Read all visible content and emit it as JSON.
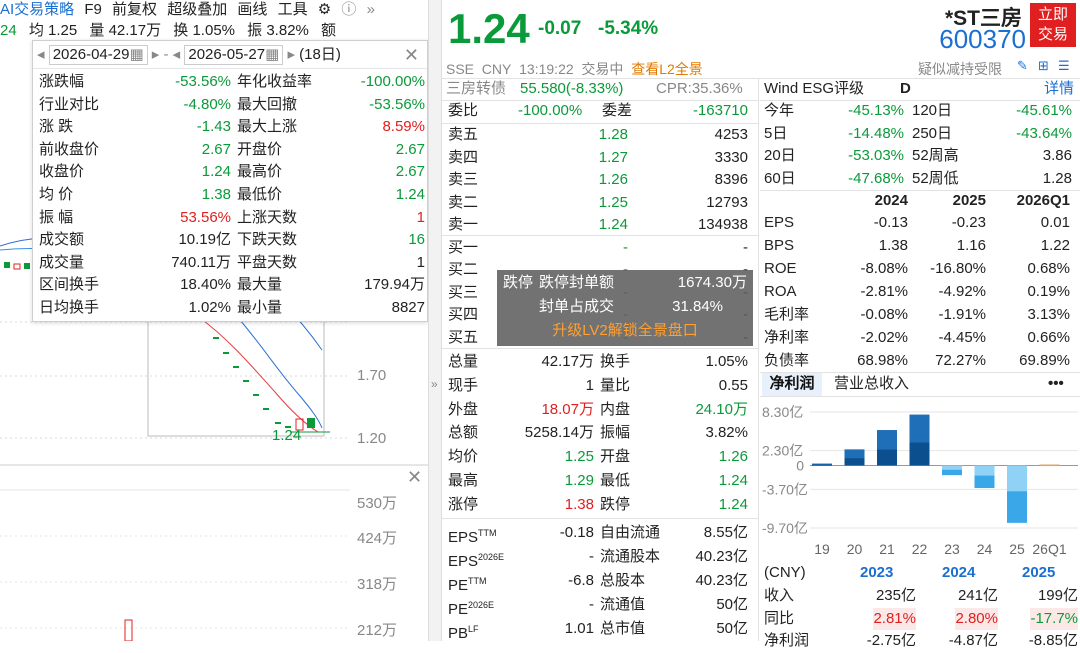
{
  "top": {
    "tools": [
      "AI交易策略",
      "F9",
      "前复权",
      "超级叠加",
      "画线",
      "工具"
    ],
    "stats": [
      "24",
      "均 1.25",
      "量 42.17万",
      "换 1.05%",
      "振 3.82%",
      "额"
    ]
  },
  "popup": {
    "date_from": "2026-04-29",
    "date_to": "2026-05-27",
    "days": "(18日)",
    "rows": [
      {
        "l1": "涨跌幅",
        "v1": "-53.56%",
        "c1": "green",
        "l2": "年化收益率",
        "v2": "-100.00%",
        "c2": "green"
      },
      {
        "l1": "行业对比",
        "v1": "-4.80%",
        "c1": "green",
        "l2": "最大回撤",
        "v2": "-53.56%",
        "c2": "green"
      },
      {
        "l1": "涨  跌",
        "v1": "-1.43",
        "c1": "green",
        "l2": "最大上涨",
        "v2": "8.59%",
        "c2": "red"
      },
      {
        "l1": "前收盘价",
        "v1": "2.67",
        "c1": "green",
        "l2": "开盘价",
        "v2": "2.67",
        "c2": "green"
      },
      {
        "l1": "收盘价",
        "v1": "1.24",
        "c1": "green",
        "l2": "最高价",
        "v2": "2.67",
        "c2": "green"
      },
      {
        "l1": "均  价",
        "v1": "1.38",
        "c1": "green",
        "l2": "最低价",
        "v2": "1.24",
        "c2": "green"
      },
      {
        "l1": "振  幅",
        "v1": "53.56%",
        "c1": "red",
        "l2": "上涨天数",
        "v2": "1",
        "c2": "red"
      },
      {
        "l1": "成交额",
        "v1": "10.19亿",
        "c1": "",
        "l2": "下跌天数",
        "v2": "16",
        "c2": "green"
      },
      {
        "l1": "成交量",
        "v1": "740.11万",
        "c1": "",
        "l2": "平盘天数",
        "v2": "1",
        "c2": ""
      },
      {
        "l1": "区间换手",
        "v1": "18.40%",
        "c1": "",
        "l2": "最大量",
        "v2": "179.94万",
        "c2": ""
      },
      {
        "l1": "日均换手",
        "v1": "1.02%",
        "c1": "",
        "l2": "最小量",
        "v2": "8827",
        "c2": ""
      }
    ]
  },
  "chart_axis": {
    "price_ticks": [
      "1.70",
      "1.20"
    ],
    "last_price": "1.24",
    "vol_ticks": [
      "530万",
      "424万",
      "318万",
      "212万"
    ]
  },
  "quote": {
    "price": "1.24",
    "change": "-0.07",
    "change_pct": "-5.34%",
    "name": "*ST三房",
    "code": "600370",
    "trade_btn": [
      "立即",
      "交易"
    ],
    "exchange": "SSE",
    "currency": "CNY",
    "time": "13:19:22",
    "status": "交易中",
    "l2_link": "查看L2全景",
    "risk": "疑似减持受限"
  },
  "bond": {
    "name": "三房转债",
    "price": "55.580(-8.33%)",
    "cpr": "CPR:35.36%"
  },
  "orderbook": {
    "weibi_label": "委比",
    "weibi": "-100.00%",
    "weicha_label": "委差",
    "weicha": "-163710",
    "asks": [
      {
        "label": "卖五",
        "price": "1.28",
        "vol": "4253"
      },
      {
        "label": "卖四",
        "price": "1.27",
        "vol": "3330"
      },
      {
        "label": "卖三",
        "price": "1.26",
        "vol": "8396"
      },
      {
        "label": "卖二",
        "price": "1.25",
        "vol": "12793"
      },
      {
        "label": "卖一",
        "price": "1.24",
        "vol": "134938"
      }
    ],
    "bids": [
      {
        "label": "买一",
        "price": "-",
        "vol": "-"
      },
      {
        "label": "买二",
        "price": "-",
        "vol": "-"
      },
      {
        "label": "买三",
        "price": "-",
        "vol": "-"
      },
      {
        "label": "买四",
        "price": "-",
        "vol": "-"
      },
      {
        "label": "买五",
        "price": "-",
        "vol": "-"
      }
    ]
  },
  "overlay": {
    "r1a": "跌停",
    "r1b": "跌停封单额",
    "r1c": "1674.30万",
    "r2a": "封单占成交",
    "r2b": "31.84%",
    "r3": "升级LV2解锁全景盘口"
  },
  "summary": [
    {
      "l1": "总量",
      "v1": "42.17万",
      "c1": "",
      "l2": "换手",
      "v2": "1.05%",
      "c2": ""
    },
    {
      "l1": "现手",
      "v1": "1",
      "c1": "",
      "l2": "量比",
      "v2": "0.55",
      "c2": ""
    },
    {
      "l1": "外盘",
      "v1": "18.07万",
      "c1": "red",
      "l2": "内盘",
      "v2": "24.10万",
      "c2": "green"
    },
    {
      "l1": "总额",
      "v1": "5258.14万",
      "c1": "",
      "l2": "振幅",
      "v2": "3.82%",
      "c2": ""
    },
    {
      "l1": "均价",
      "v1": "1.25",
      "c1": "green",
      "l2": "开盘",
      "v2": "1.26",
      "c2": "green"
    },
    {
      "l1": "最高",
      "v1": "1.29",
      "c1": "green",
      "l2": "最低",
      "v2": "1.24",
      "c2": "green"
    },
    {
      "l1": "涨停",
      "v1": "1.38",
      "c1": "red",
      "l2": "跌停",
      "v2": "1.24",
      "c2": "green"
    }
  ],
  "valuation": [
    {
      "l1": "EPS",
      "s1": "TTM",
      "v1": "-0.18",
      "l2": "自由流通",
      "v2": "8.55亿"
    },
    {
      "l1": "EPS",
      "s1": "2026E",
      "v1": "-",
      "l2": "流通股本",
      "v2": "40.23亿"
    },
    {
      "l1": "PE",
      "s1": "TTM",
      "v1": "-6.8",
      "l2": "总股本",
      "v2": "40.23亿"
    },
    {
      "l1": "PE",
      "s1": "2026E",
      "v1": "-",
      "l2": "流通值",
      "v2": "50亿"
    },
    {
      "l1": "PB",
      "s1": "LF",
      "v1": "1.01",
      "l2": "总市值",
      "v2": "50亿"
    }
  ],
  "esg": {
    "label": "Wind ESG评级",
    "grade": "D",
    "detail": "详情"
  },
  "returns": [
    {
      "l1": "今年",
      "v1": "-45.13%",
      "l2": "120日",
      "v2": "-45.61%"
    },
    {
      "l1": "5日",
      "v1": "-14.48%",
      "l2": "250日",
      "v2": "-43.64%"
    },
    {
      "l1": "20日",
      "v1": "-53.03%",
      "l2": "52周高",
      "v2": "3.86"
    },
    {
      "l1": "60日",
      "v1": "-47.68%",
      "l2": "52周低",
      "v2": "1.28"
    }
  ],
  "fin": {
    "headers": [
      "2024",
      "2025",
      "2026Q1"
    ],
    "rows": [
      {
        "label": "EPS",
        "vals": [
          "-0.13",
          "-0.23",
          "0.01"
        ]
      },
      {
        "label": "BPS",
        "vals": [
          "1.38",
          "1.16",
          "1.22"
        ]
      },
      {
        "label": "ROE",
        "vals": [
          "-8.08%",
          "-16.80%",
          "0.68%"
        ]
      },
      {
        "label": "ROA",
        "vals": [
          "-2.81%",
          "-4.92%",
          "0.19%"
        ]
      },
      {
        "label": "毛利率",
        "vals": [
          "-0.08%",
          "-1.91%",
          "3.13%"
        ]
      },
      {
        "label": "净利率",
        "vals": [
          "-2.02%",
          "-4.45%",
          "0.66%"
        ]
      },
      {
        "label": "负债率",
        "vals": [
          "68.98%",
          "72.27%",
          "69.89%"
        ]
      }
    ]
  },
  "bartabs": {
    "tab1": "净利润",
    "tab2": "营业总收入",
    "more": "•••"
  },
  "chart_data": {
    "type": "bar",
    "categories": [
      "19",
      "20",
      "21",
      "22",
      "23",
      "24",
      "25",
      "26Q1"
    ],
    "y_ticks": [
      "8.30亿",
      "2.30亿",
      "0",
      "-3.70亿",
      "-9.70亿"
    ],
    "ylim": [
      -9.7,
      8.3
    ],
    "values": [
      0.3,
      2.5,
      5.5,
      7.9,
      -1.5,
      -3.5,
      -8.9,
      0.15
    ]
  },
  "annual": {
    "unit": "(CNY)",
    "years": [
      "2023",
      "2024",
      "2025"
    ],
    "rows": [
      {
        "label": "收入",
        "vals": [
          "235亿",
          "241亿",
          "199亿"
        ],
        "color": ""
      },
      {
        "label": "同比",
        "vals": [
          "2.81%",
          "2.80%",
          "-17.7%"
        ],
        "color": "mixed"
      },
      {
        "label": "净利润",
        "vals": [
          "-2.75亿",
          "-4.87亿",
          "-8.85亿"
        ],
        "color": ""
      }
    ]
  }
}
